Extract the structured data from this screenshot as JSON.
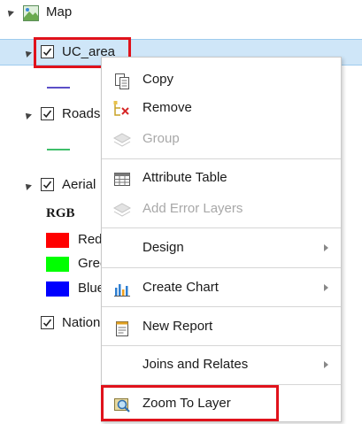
{
  "tree": {
    "map_label": "Map",
    "uc_area_label": "UC_area",
    "roads_label": "Roads",
    "aerial_label": "Aerial",
    "rgb_label": "RGB",
    "red_label": "Red",
    "green_label": "Green",
    "blue_label": "Blue",
    "national_label": "National"
  },
  "colors": {
    "uc_area_line": "#5b4fc7",
    "roads_line": "#3fbf6a",
    "red": "#ff0000",
    "green": "#00ff00",
    "blue": "#0000ff",
    "highlight": "#e0121b"
  },
  "menu": {
    "copy": "Copy",
    "remove": "Remove",
    "group": "Group",
    "attribute_table": "Attribute Table",
    "add_error_layers": "Add Error Layers",
    "design": "Design",
    "create_chart": "Create Chart",
    "new_report": "New Report",
    "joins_and_relates": "Joins and Relates",
    "zoom_to_layer": "Zoom To Layer"
  }
}
